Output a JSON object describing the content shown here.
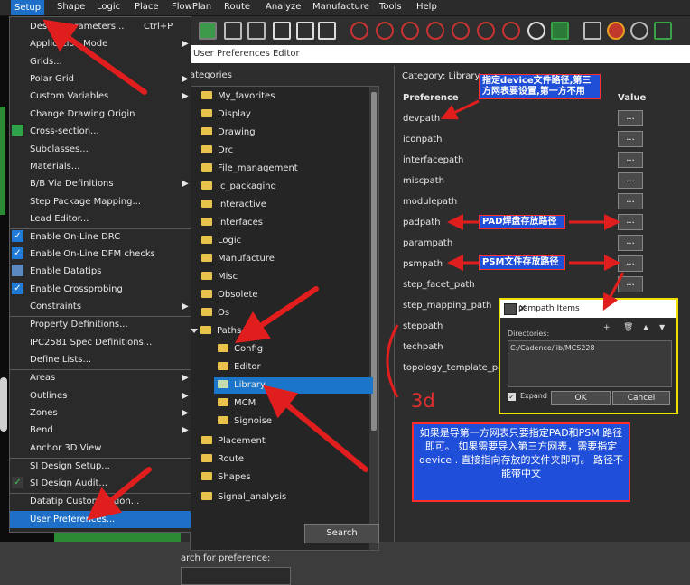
{
  "menubar": {
    "items": [
      "Setup",
      "Shape",
      "Logic",
      "Place",
      "FlowPlan",
      "Route",
      "Analyze",
      "Manufacture",
      "Tools",
      "Help"
    ]
  },
  "setup_menu": {
    "items": [
      {
        "label": "Design Parameters...",
        "shortcut": "Ctrl+P"
      },
      {
        "label": "Application Mode",
        "submenu": "▶"
      },
      {
        "label": "Grids..."
      },
      {
        "label": "Polar Grid",
        "submenu": "▶"
      },
      {
        "label": "Custom Variables",
        "submenu": "▶"
      },
      {
        "label": "Change Drawing Origin"
      },
      {
        "label": "Cross-section..."
      },
      {
        "label": "Subclasses..."
      },
      {
        "label": "Materials..."
      },
      {
        "label": "B/B Via Definitions",
        "submenu": "▶"
      },
      {
        "label": "Step Package Mapping..."
      },
      {
        "label": "Lead Editor..."
      },
      {
        "label": "Enable On-Line DRC",
        "checked": "✓"
      },
      {
        "label": "Enable On-Line DFM checks",
        "checked": "✓"
      },
      {
        "label": "Enable Datatips"
      },
      {
        "label": "Enable Crossprobing",
        "checked": "✓"
      },
      {
        "label": "Constraints",
        "submenu": "▶"
      },
      {
        "label": "Property Definitions..."
      },
      {
        "label": "IPC2581 Spec Definitions..."
      },
      {
        "label": "Define Lists..."
      },
      {
        "label": "Areas",
        "submenu": "▶"
      },
      {
        "label": "Outlines",
        "submenu": "▶"
      },
      {
        "label": "Zones",
        "submenu": "▶"
      },
      {
        "label": "Bend",
        "submenu": "▶"
      },
      {
        "label": "Anchor 3D View"
      },
      {
        "label": "SI Design Setup..."
      },
      {
        "label": "SI Design Audit..."
      },
      {
        "label": "Datatip Customization..."
      },
      {
        "label": "User Preferences..."
      }
    ]
  },
  "dialog": {
    "title": "User Preferences Editor",
    "categories_label": "ategories",
    "search_label": "arch for preference:",
    "search_button": "Search",
    "tree": [
      {
        "label": "My_favorites"
      },
      {
        "label": "Display"
      },
      {
        "label": "Drawing"
      },
      {
        "label": "Drc"
      },
      {
        "label": "File_management"
      },
      {
        "label": "Ic_packaging"
      },
      {
        "label": "Interactive"
      },
      {
        "label": "Interfaces"
      },
      {
        "label": "Logic"
      },
      {
        "label": "Manufacture"
      },
      {
        "label": "Misc"
      },
      {
        "label": "Obsolete"
      },
      {
        "label": "Os"
      },
      {
        "label": "Paths"
      },
      {
        "label": "Config"
      },
      {
        "label": "Editor"
      },
      {
        "label": "Library"
      },
      {
        "label": "MCM"
      },
      {
        "label": "Signoise"
      },
      {
        "label": "Placement"
      },
      {
        "label": "Route"
      },
      {
        "label": "Shapes"
      },
      {
        "label": "Signal_analysis"
      }
    ],
    "category_text": "Category:  Library",
    "preference_header": "Preference",
    "value_header": "Value",
    "value_button": "...",
    "preferences": [
      "devpath",
      "iconpath",
      "interfacepath",
      "miscpath",
      "modulepath",
      "padpath",
      "parampath",
      "psmpath",
      "step_facet_path",
      "step_mapping_path",
      "steppath",
      "techpath",
      "topology_template_path"
    ]
  },
  "popup": {
    "title": "psmpath Items",
    "dir_label": "Directories:",
    "path": "C:/Cadence/lib/MCS228",
    "expand_label": "Expand",
    "ok": "OK",
    "cancel": "Cancel"
  },
  "annotations": {
    "note_devpath": "指定device文件路径,第三方网表要设置,第一方不用",
    "note_padpath": "PAD焊盘存放路径",
    "note_psmpath": "PSM文件存放路径",
    "label_3d": "3d",
    "big_note": "如果是导第一方网表只要指定PAD和PSM 路径即可。 如果需要导入第三方网表，需要指定device . 直接指向存放的文件夹即可。 路径不能带中文"
  },
  "colors": {
    "accent": "#1e6fc7",
    "arrow": "#e01e1e",
    "note_bg": "#1f4fd8"
  }
}
